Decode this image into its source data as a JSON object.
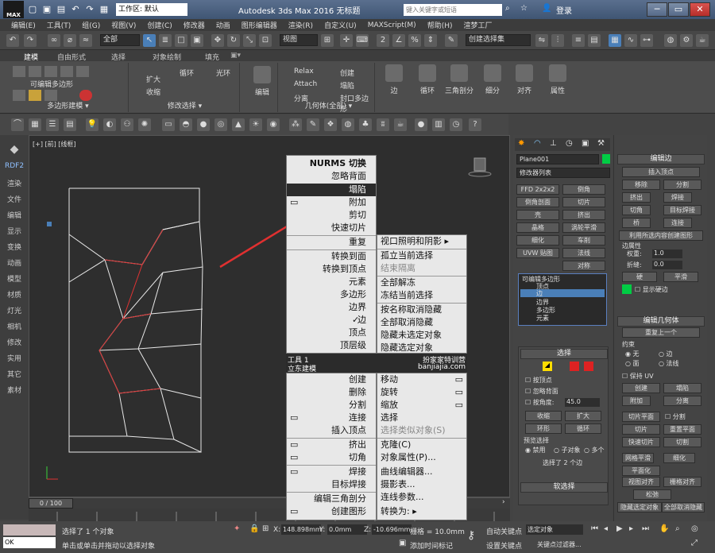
{
  "titlebar": {
    "logo": "MAX",
    "workspace": "工作区: 默认",
    "title": "Autodesk 3ds Max 2016    无标题",
    "search_placeholder": "键入关键字或短语",
    "login": "登录"
  },
  "menu": [
    "编辑(E)",
    "工具(T)",
    "组(G)",
    "视图(V)",
    "创建(C)",
    "修改器",
    "动画",
    "图形编辑器",
    "渲染(R)",
    "自定义(U)",
    "MAXScript(M)",
    "帮助(H)",
    "渲梦工厂"
  ],
  "toolbar1": {
    "filter": "全部",
    "view": "视图",
    "selection_set": "创建选择集"
  },
  "ribbon_tabs": [
    "建模",
    "自由形式",
    "选择",
    "对象绘制",
    "填充"
  ],
  "ribbon": {
    "poly_modeling": {
      "title": "可编辑多边形",
      "label": "多边形建模 ▾"
    },
    "modify_selection": {
      "label": "修改选择 ▾",
      "items": [
        "扩大",
        "收缩",
        "循环",
        "光环"
      ]
    },
    "edit": {
      "label": "编辑"
    },
    "geometry": {
      "label": "几何体(全部) ▾",
      "items": [
        "Relax",
        "Attach",
        "分离",
        "创建",
        "塌陷",
        "封口多边形"
      ]
    },
    "edge_tools": [
      "边",
      "循环",
      "三角剖分",
      "细分",
      "对齐",
      "属性"
    ]
  },
  "left_panel": [
    "RDF2",
    "渲染",
    "文件",
    "编辑",
    "显示",
    "变换",
    "动画",
    "模型",
    "材质",
    "灯光",
    "相机",
    "修改",
    "实用",
    "其它",
    "素材"
  ],
  "viewport": {
    "label": "[+] [前] [线框]"
  },
  "quad_menu": {
    "left_top": [
      "NURMS 切换",
      "忽略背面",
      "塌陷",
      "附加",
      "剪切",
      "快速切片",
      "重复",
      "转换到面",
      "转换到顶点",
      "元素",
      "多边形",
      "边界",
      "边",
      "顶点",
      "顶层级"
    ],
    "highlight": "塌陷",
    "right_top": [
      "视口照明和阴影 ▸",
      "孤立当前选择",
      "结束隔离",
      "全部解冻",
      "冻结当前选择",
      "按名称取消隐藏",
      "全部取消隐藏",
      "隐藏未选定对象",
      "隐藏选定对象"
    ],
    "header_left_1": "工具 1",
    "header_left_2": "立东建模",
    "header_right_1": "扮家家特训营",
    "header_right_2": "banjiajia.com",
    "left_bottom": [
      "创建",
      "删除",
      "分割",
      "连接",
      "插入顶点",
      "挤出",
      "切角",
      "焊接",
      "目标焊接",
      "编辑三角剖分",
      "创建图形"
    ],
    "right_bottom": [
      "移动",
      "旋转",
      "缩放",
      "选择",
      "选择类似对象(S)",
      "克隆(C)",
      "对象属性(P)...",
      "曲线编辑器...",
      "摄影表...",
      "连线参数...",
      "转换为: ▸"
    ]
  },
  "command_panel": {
    "object_name": "Plane001",
    "modifier_list": "修改器列表",
    "buttons": [
      "FFD 2x2x2",
      "倒角",
      "倒角剖面",
      "切片",
      "壳",
      "挤出",
      "晶格",
      "涡轮平滑",
      "细化",
      "车削",
      "UVW 贴图",
      "法线",
      "",
      "对称"
    ],
    "stack": [
      "可编辑多边形",
      "顶点",
      "边",
      "边界",
      "多边形",
      "元素"
    ],
    "selection_title": "选择",
    "by_vertex": "按顶点",
    "ignore_back": "忽略背面",
    "by_angle": "按角度:",
    "angle_value": "45.0",
    "shrink": "收缩",
    "grow": "扩大",
    "ring": "环形",
    "loop": "循环",
    "preview": "预览选择",
    "disable": "禁用",
    "subobj": "子对象",
    "multi": "多个",
    "selected": "选择了 2 个边",
    "soft_select": "软选择"
  },
  "rollout": {
    "edit_edges_title": "编辑边",
    "insert_vertex": "插入顶点",
    "remove": "移除",
    "split": "分割",
    "extrude": "挤出",
    "weld": "焊接",
    "chamfer": "切角",
    "target_weld": "目标焊接",
    "bridge": "桥",
    "connect": "连接",
    "create_shape": "利用所选内容创建图形",
    "edge_props": "边属性",
    "weight_label": "权重:",
    "weight_value": "1.0",
    "crease_label": "折缝:",
    "crease_value": "0.0",
    "hard": "硬",
    "smooth": "平滑",
    "show_hard": "显示硬边",
    "edit_geo_title": "编辑几何体",
    "repeat_last": "重复上一个",
    "constraints": "约束",
    "none": "无",
    "edge": "边",
    "face": "面",
    "normal": "法线",
    "keep_uv": "保持 UV",
    "create": "创建",
    "collapse": "塌陷",
    "attach": "附加",
    "detach": "分离",
    "slice_plane": "切片平面",
    "split2": "分割",
    "slice": "切片",
    "reset_plane": "重置平面",
    "quickslice": "快速切片",
    "cut": "切割",
    "meshsmooth": "网格平滑",
    "tessellate": "细化",
    "planarize": "平面化",
    "view_align": "视图对齐",
    "grid_align": "栅格对齐",
    "relax": "松弛",
    "hide_sel": "隐藏选定对象",
    "unhide_all": "全部取消隐藏"
  },
  "timeline": {
    "frame": "0 / 100"
  },
  "status": {
    "selected": "选择了 1 个对象",
    "hint": "单击或单击并拖动以选择对象",
    "x_label": "X:",
    "x": "148.898mm",
    "y_label": "Y:",
    "y": "0.0mm",
    "z_label": "Z:",
    "z": "-10.696mm",
    "grid": "栅格 = 10.0mm",
    "auto_key": "自动关键点",
    "set_key": "设置关键点",
    "selected_obj": "选定对象",
    "key_filters": "关键点过滤器...",
    "add_time_tag": "添加时间标记",
    "ok": "OK"
  },
  "colors": {
    "accent": "#ffdd00",
    "highlight_bar": "#2b2b2b",
    "object_color": "#00cc44",
    "arrow": "#e03030"
  }
}
